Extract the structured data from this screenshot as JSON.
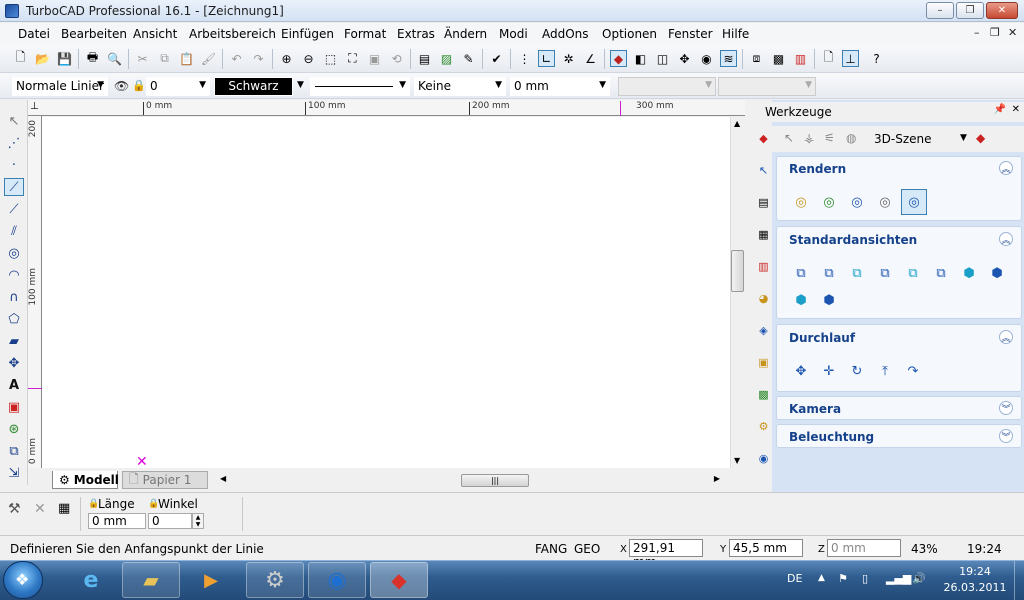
{
  "app": {
    "title": "TurboCAD Professional 16.1 - [Zeichnung1]"
  },
  "window_controls": {
    "minimize": "–",
    "maximize": "❐",
    "close": "✕"
  },
  "mdi_controls": {
    "minimize": "–",
    "restore": "❐",
    "close": "✕"
  },
  "menu": {
    "items": [
      {
        "label": "Datei"
      },
      {
        "label": "Bearbeiten"
      },
      {
        "label": "Ansicht"
      },
      {
        "label": "Arbeitsbereich"
      },
      {
        "label": "Einfügen"
      },
      {
        "label": "Format"
      },
      {
        "label": "Extras"
      },
      {
        "label": "Ändern"
      },
      {
        "label": "Modi"
      },
      {
        "label": "AddOns"
      },
      {
        "label": "Optionen"
      },
      {
        "label": "Fenster"
      },
      {
        "label": "Hilfe"
      }
    ]
  },
  "props_bar": {
    "linetype": "Normale Linier",
    "layer_value": "0",
    "color": "Schwarz",
    "pattern": "Keine",
    "thickness": "0 mm"
  },
  "ruler": {
    "top_labels": [
      "0 mm",
      "100 mm",
      "200 mm",
      "300 mm"
    ],
    "left_labels": [
      "200",
      "100 mm",
      "0 mm"
    ]
  },
  "tabs": {
    "model": "Modell",
    "paper": "Papier 1"
  },
  "panel": {
    "title": "Werkzeuge",
    "scene": "3D-Szene",
    "sections": [
      {
        "title": "Rendern",
        "expanded": true
      },
      {
        "title": "Standardansichten",
        "expanded": true
      },
      {
        "title": "Durchlauf",
        "expanded": true
      },
      {
        "title": "Kamera",
        "expanded": false
      },
      {
        "title": "Beleuchtung",
        "expanded": false
      }
    ]
  },
  "command": {
    "length_label": "Länge",
    "length_value": "0 mm",
    "angle_label": "Winkel",
    "angle_value": "0"
  },
  "status": {
    "prompt": "Definieren Sie den Anfangspunkt der Linie",
    "fang": "FANG",
    "geo": "GEO",
    "x_label": "X",
    "x_value": "291,91 mm",
    "y_label": "Y",
    "y_value": "45,5 mm",
    "z_label": "Z",
    "z_value": "0 mm",
    "zoom": "43%",
    "time": "19:24"
  },
  "taskbar": {
    "lang": "DE",
    "clock_time": "19:24",
    "clock_date": "26.03.2011"
  },
  "colors": {
    "accent": "#15428b",
    "panel_bg": "#d6e3f5",
    "taskbar": "#2f5d8f"
  }
}
